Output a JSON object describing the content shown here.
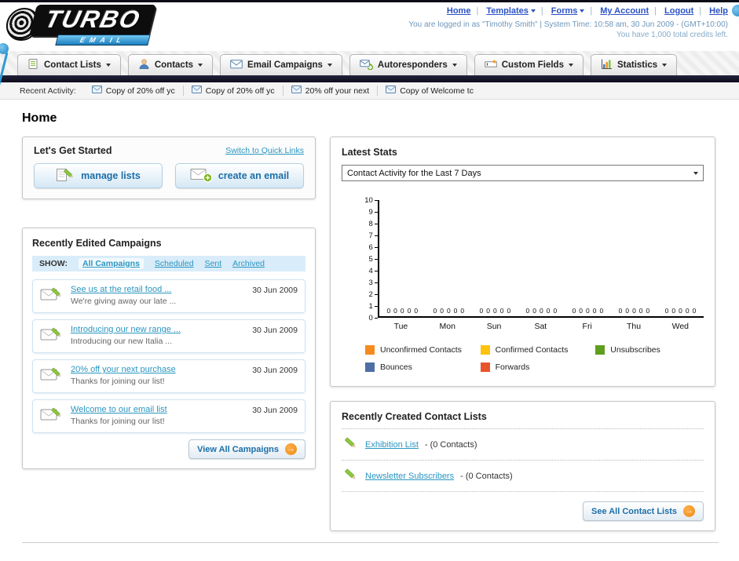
{
  "colors": {
    "link": "#2a96c0",
    "accent_orange": "#f7941d",
    "nav_dark_bar": "#0e0d1c",
    "button_text": "#1d6fa8"
  },
  "header": {
    "logo_main": "TURBO",
    "logo_sub": "EMAIL",
    "links": [
      {
        "label": "Home"
      },
      {
        "label": "Templates"
      },
      {
        "label": "Forms"
      },
      {
        "label": "My Account"
      },
      {
        "label": "Logout"
      },
      {
        "label": "Help"
      }
    ],
    "login_info": "You are logged in as \"Timothy Smith\" | System Time: 10:58 am, 30 Jun 2009 - (GMT+10:00)",
    "credits_info": "You have 1,000 total credits left."
  },
  "nav": {
    "items": [
      {
        "label": "Contact Lists",
        "icon": "contact-lists-icon"
      },
      {
        "label": "Contacts",
        "icon": "contacts-icon"
      },
      {
        "label": "Email Campaigns",
        "icon": "email-campaigns-icon"
      },
      {
        "label": "Autoresponders",
        "icon": "autoresponders-icon"
      },
      {
        "label": "Custom Fields",
        "icon": "custom-fields-icon"
      },
      {
        "label": "Statistics",
        "icon": "statistics-icon"
      }
    ]
  },
  "recent_activity": {
    "label": "Recent Activity:",
    "items": [
      {
        "text": "Copy of 20% off yc"
      },
      {
        "text": "Copy of 20% off yc"
      },
      {
        "text": "20% off your next"
      },
      {
        "text": "Copy of Welcome tc"
      }
    ]
  },
  "page_title": "Home",
  "get_started": {
    "title": "Let's Get Started",
    "switch_link": "Switch to Quick Links",
    "manage_lists_label": "manage lists",
    "manage_lists_icon": "pencil-paper-icon",
    "create_email_label": "create an email",
    "create_email_icon": "envelope-plus-icon"
  },
  "campaigns": {
    "title": "Recently Edited Campaigns",
    "show_label": "SHOW:",
    "tabs": [
      {
        "label": "All Campaigns",
        "active": true
      },
      {
        "label": "Scheduled",
        "active": false
      },
      {
        "label": "Sent",
        "active": false
      },
      {
        "label": "Archived",
        "active": false
      }
    ],
    "items": [
      {
        "title": "See us at the retail food ...",
        "subtitle": "We're giving away our late ...",
        "date": "30 Jun 2009"
      },
      {
        "title": "Introducing our new range ...",
        "subtitle": "Introducing our new Italia ...",
        "date": "30 Jun 2009"
      },
      {
        "title": "20% off your next purchase",
        "subtitle": "Thanks for joining our list!",
        "date": "30 Jun 2009"
      },
      {
        "title": "Welcome to our email list",
        "subtitle": "Thanks for joining our list!",
        "date": "30 Jun 2009"
      }
    ],
    "view_all_label": "View All Campaigns"
  },
  "stats": {
    "title": "Latest Stats",
    "dropdown_value": "Contact Activity for the Last 7 Days",
    "chart_data": {
      "type": "bar",
      "categories": [
        "Tue",
        "Mon",
        "Sun",
        "Sat",
        "Fri",
        "Thu",
        "Wed"
      ],
      "series": [
        {
          "name": "Unconfirmed Contacts",
          "color": "#f68b1f",
          "values": [
            0,
            0,
            0,
            0,
            0,
            0,
            0
          ]
        },
        {
          "name": "Confirmed Contacts",
          "color": "#ffc20e",
          "values": [
            0,
            0,
            0,
            0,
            0,
            0,
            0
          ]
        },
        {
          "name": "Unsubscribes",
          "color": "#5f9e1e",
          "values": [
            0,
            0,
            0,
            0,
            0,
            0,
            0
          ]
        },
        {
          "name": "Bounces",
          "color": "#4e6fa5",
          "values": [
            0,
            0,
            0,
            0,
            0,
            0,
            0
          ]
        },
        {
          "name": "Forwards",
          "color": "#e8542a",
          "values": [
            0,
            0,
            0,
            0,
            0,
            0,
            0
          ]
        }
      ],
      "title": "Contact Activity for the Last 7 Days",
      "xlabel": "",
      "ylabel": "",
      "ylim": [
        0,
        10
      ],
      "ytick_step": 1,
      "grid": false,
      "legend_position": "bottom"
    }
  },
  "contact_lists": {
    "title": "Recently Created Contact Lists",
    "items": [
      {
        "name": "Exhibition List",
        "count": "- (0 Contacts)"
      },
      {
        "name": "Newsletter Subscribers",
        "count": "- (0 Contacts)"
      }
    ],
    "see_all_label": "See All Contact Lists"
  }
}
